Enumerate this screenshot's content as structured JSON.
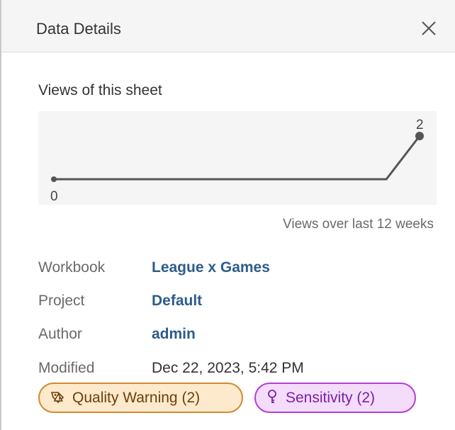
{
  "panel": {
    "title": "Data Details"
  },
  "views": {
    "section_title": "Views of this sheet",
    "min_label": "0",
    "max_label": "2",
    "caption": "Views over last 12 weeks"
  },
  "chart_data": {
    "type": "line",
    "x": [
      1,
      2,
      3,
      4,
      5,
      6,
      7,
      8,
      9,
      10,
      11,
      12
    ],
    "values": [
      0,
      0,
      0,
      0,
      0,
      0,
      0,
      0,
      0,
      0,
      0,
      2
    ],
    "ylim": [
      0,
      2
    ],
    "grid": false,
    "title": "",
    "xlabel": "",
    "ylabel": ""
  },
  "details": {
    "workbook_label": "Workbook",
    "workbook_value": "League x Games",
    "project_label": "Project",
    "project_value": "Default",
    "author_label": "Author",
    "author_value": "admin",
    "modified_label": "Modified",
    "modified_value": "Dec 22, 2023, 5:42 PM"
  },
  "badges": {
    "quality_warning": "Quality Warning (2)",
    "sensitivity": "Sensitivity (2)"
  },
  "colors": {
    "link": "#2e5c8a",
    "warning_border": "#d08a2e",
    "warning_fill": "#fde9cc",
    "sensitivity_border": "#b23fd6",
    "sensitivity_fill": "#f4dcfb",
    "sparkline": "#555555"
  },
  "icons": {
    "close": "close-icon",
    "quality_warning": "quality-warning-icon",
    "sensitivity": "sensitivity-icon"
  }
}
